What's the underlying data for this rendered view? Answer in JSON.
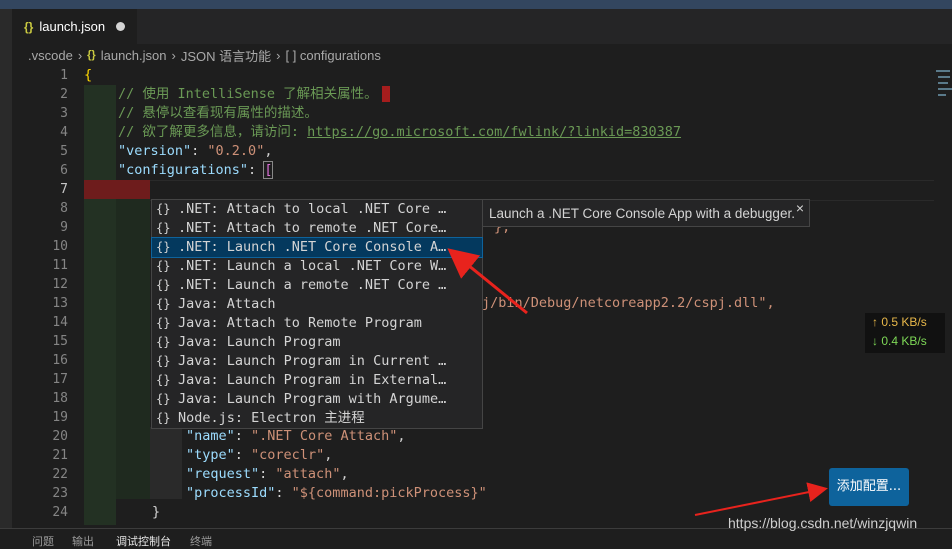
{
  "tab": {
    "icon": "{}",
    "title": "launch.json"
  },
  "breadcrumb": [
    ".vscode",
    "launch.json",
    "JSON 语言功能",
    "[ ] configurations"
  ],
  "line_numbers": [
    "1",
    "2",
    "3",
    "4",
    "5",
    "6",
    "7",
    "8",
    "9",
    "10",
    "11",
    "12",
    "13",
    "14",
    "15",
    "16",
    "17",
    "18",
    "19",
    "20",
    "21",
    "22",
    "23",
    "24"
  ],
  "code": {
    "l1": "{",
    "l2_comment": "// 使用 IntelliSense 了解相关属性。",
    "l3_comment": "// 悬停以查看现有属性的描述。",
    "l4_comment": "// 欲了解更多信息，请访问: ",
    "l4_link": "https://go.microsoft.com/fwlink/?linkid=830387",
    "l5_key": "\"version\"",
    "l5_val": "\"0.2.0\"",
    "l6_key": "\"configurations\"",
    "l6_bracket": "[",
    "l9_frag": "},",
    "l13_frag": "j/bin/Debug/netcoreapp2.2/cspj.dll\",",
    "l20_key": "\"name\"",
    "l20_val": "\".NET Core Attach\"",
    "l21_key": "\"type\"",
    "l21_val": "\"coreclr\"",
    "l22_key": "\"request\"",
    "l22_val": "\"attach\"",
    "l23_key": "\"processId\"",
    "l23_val": "\"${command:pickProcess}\"",
    "l24": "}"
  },
  "suggestions": [
    {
      "icon": "{}",
      "label": ".NET: Attach to local .NET Core …"
    },
    {
      "icon": "{}",
      "label": ".NET: Attach to remote .NET Core…"
    },
    {
      "icon": "{}",
      "label": ".NET: Launch .NET Core Console A…"
    },
    {
      "icon": "{}",
      "label": ".NET: Launch a local .NET Core W…"
    },
    {
      "icon": "{}",
      "label": ".NET: Launch a remote .NET Core …"
    },
    {
      "icon": "{}",
      "label": "Java: Attach"
    },
    {
      "icon": "{}",
      "label": "Java: Attach to Remote Program"
    },
    {
      "icon": "{}",
      "label": "Java: Launch Program"
    },
    {
      "icon": "{}",
      "label": "Java: Launch Program in Current …"
    },
    {
      "icon": "{}",
      "label": "Java: Launch Program in External…"
    },
    {
      "icon": "{}",
      "label": "Java: Launch Program with Argume…"
    },
    {
      "icon": "{}",
      "label": "Node.js: Electron 主进程"
    }
  ],
  "selected_suggestion_index": 2,
  "suggestion_detail": "Launch a .NET Core Console App with a debugger.",
  "netspeed": {
    "up": "↑ 0.5 KB/s",
    "down": "↓ 0.4 KB/s"
  },
  "add_config_button": "添加配置...",
  "watermark": "https://blog.csdn.net/winzjqwin",
  "bottom_tabs": [
    "问题",
    "输出",
    "调试控制台",
    "终端"
  ],
  "colors": {
    "accent": "#0e639c",
    "arrow": "#e8231d",
    "selection": "#04395e"
  }
}
